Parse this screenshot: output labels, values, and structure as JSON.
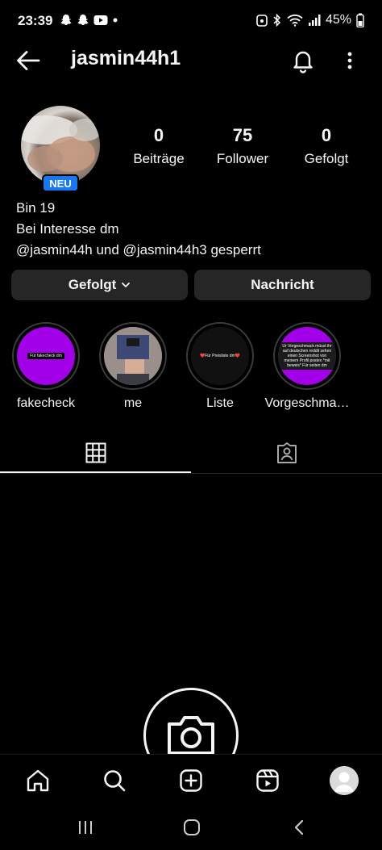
{
  "status_bar": {
    "time": "23:39",
    "battery": "45%",
    "left_icons": [
      "snapchat-icon",
      "snapchat-icon",
      "youtube-icon",
      "dot-icon"
    ],
    "right_icons": [
      "alarm-icon",
      "bluetooth-icon",
      "wifi-icon",
      "signal-icon"
    ]
  },
  "header": {
    "username": "jasmin44h1",
    "icons": [
      "back-arrow-icon",
      "bell-icon",
      "more-vertical-icon"
    ]
  },
  "profile": {
    "new_badge": "NEU",
    "badge_color": "#1877f2",
    "stats": [
      {
        "value": "0",
        "label": "Beiträge"
      },
      {
        "value": "75",
        "label": "Follower"
      },
      {
        "value": "0",
        "label": "Gefolgt"
      }
    ],
    "bio": [
      "Bin 19",
      "Bei Interesse dm",
      "@jasmin44h und @jasmin44h3 gesperrt"
    ]
  },
  "actions": {
    "follow_label": "Gefolgt",
    "message_label": "Nachricht"
  },
  "highlights": [
    {
      "label": "fakecheck",
      "cover_text": "Für fakecheck dm",
      "color": "#a100e8"
    },
    {
      "label": "me",
      "cover_text": "",
      "color": "#8a7d7a"
    },
    {
      "label": "Liste",
      "cover_text": "❤️Für Preisliste dm❤️",
      "color": "#111111"
    },
    {
      "label": "Vorgeschma…",
      "cover_text": "Ur Vorgeschmack müsst ihr auf deutschen reddit sehen einen Screenshot von meinem Profil posten *mit beweis* Für seiten dm",
      "color": "#a100e8"
    }
  ],
  "tabs": [
    {
      "name": "grid",
      "icon": "grid-icon",
      "active": true
    },
    {
      "name": "tagged",
      "icon": "tagged-person-icon",
      "active": false
    }
  ],
  "bottom_nav": [
    "home-icon",
    "search-icon",
    "create-icon",
    "reels-icon",
    "profile-avatar"
  ],
  "android_nav": [
    "recents-icon",
    "home-button-icon",
    "back-icon"
  ]
}
